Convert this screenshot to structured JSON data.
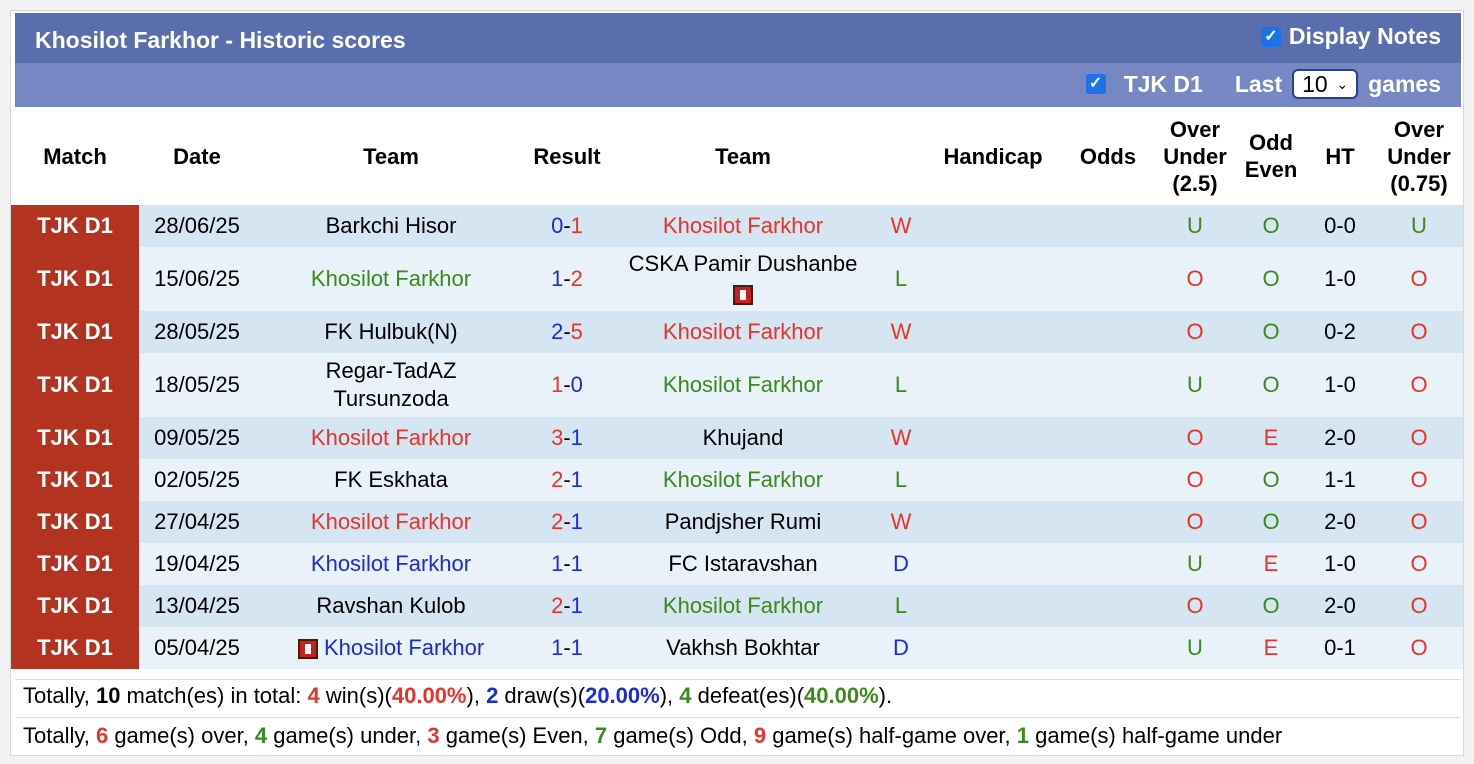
{
  "header": {
    "title": "Khosilot Farkhor - Historic scores",
    "display_notes_label": "Display Notes",
    "league_filter_label": "TJK D1",
    "last_label": "Last",
    "games_count": "10",
    "games_label": "games"
  },
  "columns": [
    "Match",
    "Date",
    "Team",
    "Result",
    "Team",
    "",
    "Handicap",
    "Odds",
    "Over Under (2.5)",
    "Odd Even",
    "HT",
    "Over Under (0.75)"
  ],
  "colors": {
    "win": "#e8332a",
    "lose": "#3a8a1c",
    "draw": "#1c2bd6",
    "league_bg": "#b13320",
    "header_bg": "#5a6dad"
  },
  "rows": [
    {
      "league": "TJK D1",
      "date": "28/06/25",
      "home": "Barkchi Hisor",
      "home_color": "",
      "home_card": false,
      "score_home": "0",
      "score_away": "1",
      "score_home_color": "blue",
      "score_away_color": "red",
      "away": "Khosilot Farkhor",
      "away_color": "red",
      "away_card": false,
      "wl": "W",
      "wl_color": "red",
      "handicap": "",
      "odds": "",
      "ou": "U",
      "ou_color": "green",
      "oe": "O",
      "oe_color": "green",
      "ht": "0-0",
      "ou2": "U",
      "ou2_color": "green"
    },
    {
      "league": "TJK D1",
      "date": "15/06/25",
      "home": "Khosilot Farkhor",
      "home_color": "green",
      "home_card": false,
      "score_home": "1",
      "score_away": "2",
      "score_home_color": "blue",
      "score_away_color": "red",
      "away": "CSKA Pamir Dushanbe",
      "away_color": "",
      "away_card": true,
      "wl": "L",
      "wl_color": "green",
      "handicap": "",
      "odds": "",
      "ou": "O",
      "ou_color": "red",
      "oe": "O",
      "oe_color": "green",
      "ht": "1-0",
      "ou2": "O",
      "ou2_color": "red"
    },
    {
      "league": "TJK D1",
      "date": "28/05/25",
      "home": "FK Hulbuk(N)",
      "home_color": "",
      "home_card": false,
      "score_home": "2",
      "score_away": "5",
      "score_home_color": "blue",
      "score_away_color": "red",
      "away": "Khosilot Farkhor",
      "away_color": "red",
      "away_card": false,
      "wl": "W",
      "wl_color": "red",
      "handicap": "",
      "odds": "",
      "ou": "O",
      "ou_color": "red",
      "oe": "O",
      "oe_color": "green",
      "ht": "0-2",
      "ou2": "O",
      "ou2_color": "red"
    },
    {
      "league": "TJK D1",
      "date": "18/05/25",
      "home": "Regar-TadAZ Tursunzoda",
      "home_color": "",
      "home_card": false,
      "score_home": "1",
      "score_away": "0",
      "score_home_color": "red",
      "score_away_color": "blue",
      "away": "Khosilot Farkhor",
      "away_color": "green",
      "away_card": false,
      "wl": "L",
      "wl_color": "green",
      "handicap": "",
      "odds": "",
      "ou": "U",
      "ou_color": "green",
      "oe": "O",
      "oe_color": "green",
      "ht": "1-0",
      "ou2": "O",
      "ou2_color": "red"
    },
    {
      "league": "TJK D1",
      "date": "09/05/25",
      "home": "Khosilot Farkhor",
      "home_color": "red",
      "home_card": false,
      "score_home": "3",
      "score_away": "1",
      "score_home_color": "red",
      "score_away_color": "blue",
      "away": "Khujand",
      "away_color": "",
      "away_card": false,
      "wl": "W",
      "wl_color": "red",
      "handicap": "",
      "odds": "",
      "ou": "O",
      "ou_color": "red",
      "oe": "E",
      "oe_color": "red",
      "ht": "2-0",
      "ou2": "O",
      "ou2_color": "red"
    },
    {
      "league": "TJK D1",
      "date": "02/05/25",
      "home": "FK Eskhata",
      "home_color": "",
      "home_card": false,
      "score_home": "2",
      "score_away": "1",
      "score_home_color": "red",
      "score_away_color": "blue",
      "away": "Khosilot Farkhor",
      "away_color": "green",
      "away_card": false,
      "wl": "L",
      "wl_color": "green",
      "handicap": "",
      "odds": "",
      "ou": "O",
      "ou_color": "red",
      "oe": "O",
      "oe_color": "green",
      "ht": "1-1",
      "ou2": "O",
      "ou2_color": "red"
    },
    {
      "league": "TJK D1",
      "date": "27/04/25",
      "home": "Khosilot Farkhor",
      "home_color": "red",
      "home_card": false,
      "score_home": "2",
      "score_away": "1",
      "score_home_color": "red",
      "score_away_color": "blue",
      "away": "Pandjsher Rumi",
      "away_color": "",
      "away_card": false,
      "wl": "W",
      "wl_color": "red",
      "handicap": "",
      "odds": "",
      "ou": "O",
      "ou_color": "red",
      "oe": "O",
      "oe_color": "green",
      "ht": "2-0",
      "ou2": "O",
      "ou2_color": "red"
    },
    {
      "league": "TJK D1",
      "date": "19/04/25",
      "home": "Khosilot Farkhor",
      "home_color": "blue",
      "home_card": false,
      "score_home": "1",
      "score_away": "1",
      "score_home_color": "blue",
      "score_away_color": "blue",
      "away": "FC Istaravshan",
      "away_color": "",
      "away_card": false,
      "wl": "D",
      "wl_color": "blue",
      "handicap": "",
      "odds": "",
      "ou": "U",
      "ou_color": "green",
      "oe": "E",
      "oe_color": "red",
      "ht": "1-0",
      "ou2": "O",
      "ou2_color": "red"
    },
    {
      "league": "TJK D1",
      "date": "13/04/25",
      "home": "Ravshan Kulob",
      "home_color": "",
      "home_card": false,
      "score_home": "2",
      "score_away": "1",
      "score_home_color": "red",
      "score_away_color": "blue",
      "away": "Khosilot Farkhor",
      "away_color": "green",
      "away_card": false,
      "wl": "L",
      "wl_color": "green",
      "handicap": "",
      "odds": "",
      "ou": "O",
      "ou_color": "red",
      "oe": "O",
      "oe_color": "green",
      "ht": "2-0",
      "ou2": "O",
      "ou2_color": "red"
    },
    {
      "league": "TJK D1",
      "date": "05/04/25",
      "home": "Khosilot Farkhor",
      "home_color": "blue",
      "home_card": true,
      "score_home": "1",
      "score_away": "1",
      "score_home_color": "blue",
      "score_away_color": "blue",
      "away": "Vakhsh Bokhtar",
      "away_color": "",
      "away_card": false,
      "wl": "D",
      "wl_color": "blue",
      "handicap": "",
      "odds": "",
      "ou": "U",
      "ou_color": "green",
      "oe": "E",
      "oe_color": "red",
      "ht": "0-1",
      "ou2": "O",
      "ou2_color": "red"
    }
  ],
  "summary1": {
    "p1": "Totally, ",
    "total": "10",
    "p2": " match(es) in total: ",
    "wins": "4",
    "p3": " win(s)(",
    "win_pct": "40.00%",
    "p4": "), ",
    "draws": "2",
    "p5": " draw(s)(",
    "draw_pct": "20.00%",
    "p6": "), ",
    "defeats": "4",
    "p7": " defeat(es)(",
    "defeat_pct": "40.00%",
    "p8": ")."
  },
  "summary2": {
    "p1": "Totally, ",
    "over": "6",
    "p2": " game(s) over, ",
    "under": "4",
    "p3": " game(s) under, ",
    "even": "3",
    "p4": " game(s) Even, ",
    "odd": "7",
    "p5": " game(s) Odd, ",
    "hg_over": "9",
    "p6": " game(s) half-game over, ",
    "hg_under": "1",
    "p7": " game(s) half-game under"
  }
}
